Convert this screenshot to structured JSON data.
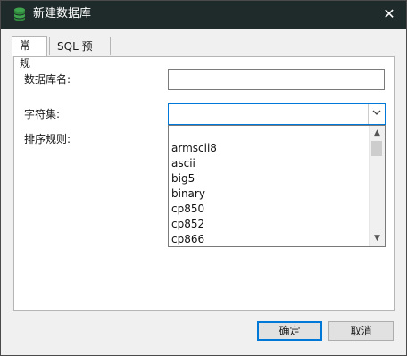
{
  "window": {
    "title": "新建数据库",
    "icon": "database-icon",
    "close_icon": "close-icon"
  },
  "tabs": [
    {
      "label": "常规",
      "active": true
    },
    {
      "label": "SQL 预览",
      "active": false
    }
  ],
  "form": {
    "db_name_label": "数据库名:",
    "db_name_value": "",
    "charset_label": "字符集:",
    "charset_value": "",
    "collation_label": "排序规则:"
  },
  "charset_dropdown": {
    "options": [
      "",
      "armscii8",
      "ascii",
      "big5",
      "binary",
      "cp850",
      "cp852",
      "cp866"
    ]
  },
  "buttons": {
    "ok": "确定",
    "cancel": "取消"
  },
  "colors": {
    "titlebar": "#1f2a2a",
    "accent": "#0078d7",
    "db_icon": "#3fa34d"
  }
}
